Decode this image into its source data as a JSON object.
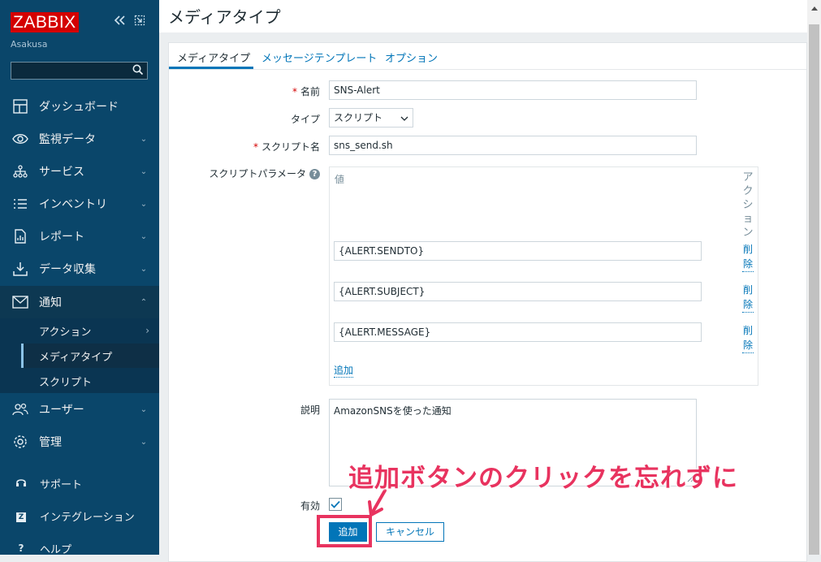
{
  "sidebar": {
    "logo": "ZABBIX",
    "server_name": "Asakusa",
    "menu": [
      {
        "label": "ダッシュボード",
        "icon": "dashboard-icon",
        "expandable": false
      },
      {
        "label": "監視データ",
        "icon": "eye-icon",
        "expandable": true
      },
      {
        "label": "サービス",
        "icon": "services-icon",
        "expandable": true
      },
      {
        "label": "インベントリ",
        "icon": "list-icon",
        "expandable": true
      },
      {
        "label": "レポート",
        "icon": "report-icon",
        "expandable": true
      },
      {
        "label": "データ収集",
        "icon": "download-icon",
        "expandable": true
      },
      {
        "label": "通知",
        "icon": "envelope-icon",
        "expandable": true,
        "open": true
      },
      {
        "label": "ユーザー",
        "icon": "users-icon",
        "expandable": true
      },
      {
        "label": "管理",
        "icon": "gear-icon",
        "expandable": true
      }
    ],
    "submenu": [
      {
        "label": "アクション",
        "has_children": true
      },
      {
        "label": "メディアタイプ",
        "active": true
      },
      {
        "label": "スクリプト"
      }
    ],
    "bottom": [
      {
        "label": "サポート",
        "icon": "headset-icon"
      },
      {
        "label": "インテグレーション",
        "icon": "integration-icon",
        "glyph": "Z"
      },
      {
        "label": "ヘルプ",
        "icon": "help-icon",
        "glyph": "?"
      }
    ]
  },
  "page": {
    "title": "メディアタイプ"
  },
  "tabs": [
    {
      "label": "メディアタイプ",
      "active": true
    },
    {
      "label": "メッセージテンプレート"
    },
    {
      "label": "オプション"
    }
  ],
  "form": {
    "name_label": "名前",
    "name_value": "SNS-Alert",
    "type_label": "タイプ",
    "type_value": "スクリプト",
    "script_label": "スクリプト名",
    "script_value": "sns_send.sh",
    "params_label": "スクリプトパラメータ",
    "params_col_value": "値",
    "params_col_action": "アクション",
    "params": [
      "{ALERT.SENDTO}",
      "{ALERT.SUBJECT}",
      "{ALERT.MESSAGE}"
    ],
    "remove_label": "削除",
    "add_param_label": "追加",
    "description_label": "説明",
    "description_value": "AmazonSNSを使った通知",
    "enabled_label": "有効",
    "enabled": true,
    "add_button": "追加",
    "cancel_button": "キャンセル"
  },
  "annotation": {
    "text": "追加ボタンのクリックを忘れずに",
    "color": "#e8335f"
  },
  "colors": {
    "sidebar_bg": "#0a466a",
    "accent": "#0275b8",
    "logo_red": "#d40000"
  }
}
